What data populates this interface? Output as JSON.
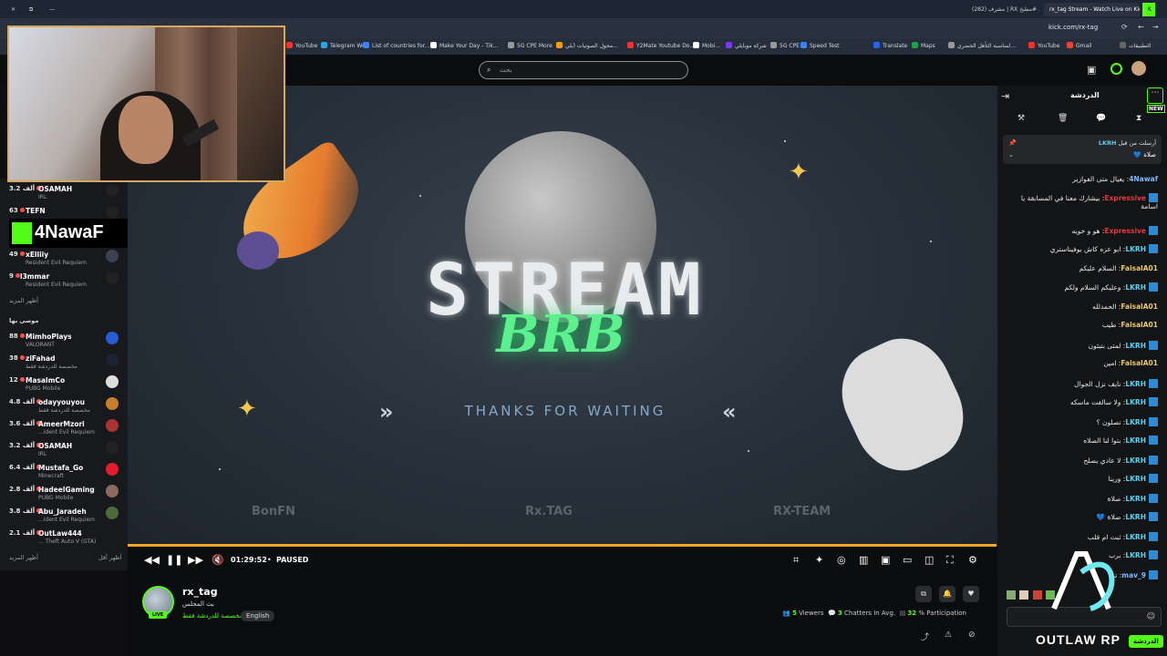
{
  "browser": {
    "tabs": [
      {
        "label": "rx_tag Stream - Watch Live on Kick",
        "active": true
      },
      {
        "label": "(282) مشرف | RX مطبخ# ...",
        "active": false
      }
    ],
    "url": "kick.com/rx-tag",
    "bookmarks": [
      "YouTube",
      "Telegram Web",
      "List of countries for...",
      "Make Your Day - Tik...",
      "5G CPE More",
      "محول الصوتيات (بلي...",
      "Y2Mate Youtube Do...",
      "Mobi...",
      "شركة موبايلي",
      "5G CPE",
      "Speed Test",
      "Translate",
      "Maps",
      "لمناسبة التأهل الحضري...",
      "YouTube",
      "Gmail",
      "التطبيقات"
    ]
  },
  "header": {
    "search_placeholder": "بحث"
  },
  "brand": {
    "letter": "K",
    "name": "4NawaF"
  },
  "sidebar": {
    "top_rows": [
      {
        "count": "3.2 ألف",
        "name": "OSAMAH",
        "sub": "IRL"
      },
      {
        "count": "63",
        "name": "TEFN",
        "sub": ""
      },
      {
        "count": "49",
        "name": "xElliiy",
        "sub": "Resident Evil Requiem"
      },
      {
        "count": "9",
        "name": "l3mmar",
        "sub": "Resident Evil Requiem"
      }
    ],
    "show_more": "أظهر المزيد",
    "recommended_title": "موصى بها",
    "recommended": [
      {
        "count": "88",
        "name": "MimhoPlays",
        "sub": "VALORANT"
      },
      {
        "count": "38",
        "name": "ziFahad",
        "sub": "مخصصة للدردشة فقط"
      },
      {
        "count": "12",
        "name": "MasalmCo",
        "sub": "PUBG Mobile"
      },
      {
        "count": "4.8 ألف",
        "name": "odayyouyou",
        "sub": "مخصصة للدردشة فقط"
      },
      {
        "count": "3.6 ألف",
        "name": "AmeerMzori",
        "sub": "...ident Evil Requiem"
      },
      {
        "count": "3.2 ألف",
        "name": "OSAMAH",
        "sub": "IRL"
      },
      {
        "count": "6.4 ألف",
        "name": "Mustafa_Go",
        "sub": "Minecraft"
      },
      {
        "count": "2.8 ألف",
        "name": "HadeelGaming",
        "sub": "PUBG Mobile"
      },
      {
        "count": "3.8 ألف",
        "name": "Abu_Jaradeh",
        "sub": "...ident Evil Requiem"
      },
      {
        "count": "2.1 ألف",
        "name": "OutLaw444",
        "sub": "... Theft Auto V (GTA)"
      }
    ],
    "show_more_bottom": "أظهر المزيد",
    "show_less": "أظهر أقل"
  },
  "video": {
    "title_big": "STREAM",
    "title_brb": "BRB",
    "thanks": "THANKS FOR WAITING",
    "sponsors": [
      "BonFN",
      "Rx.TAG",
      "RX-TEAM"
    ],
    "progress_fraction": 0.999
  },
  "controls": {
    "time": "01:29:52",
    "state": "PAUSED"
  },
  "channel": {
    "name": "rx_tag",
    "title": "بث المجلس",
    "category": "مخصصة للدردشة فقط",
    "language": "English",
    "live_badge": "LIVE",
    "viewers_num": "5",
    "viewers_label": "Viewers",
    "chatters_num": "3",
    "chatters_label": "Chatters In Avg.",
    "participation_num": "32",
    "participation_label": "% Participation"
  },
  "chat": {
    "title": "الدردشة",
    "new_badge": "NEW",
    "pinned": {
      "user": "LKRH",
      "by": "أرسلت من قبل",
      "text": "صلاة 💙"
    },
    "messages": [
      {
        "user": "4Nawaf",
        "text": "يعيال متى الفوازير",
        "color": "blue",
        "badge": false
      },
      {
        "user": "Expressive",
        "text": "بيشارك معنا في المسابقة يا اسامة",
        "color": "red",
        "badge": true
      },
      {
        "user": "Expressive",
        "text": "هو و خويه",
        "color": "red",
        "badge": true
      },
      {
        "user": "LKRH",
        "text": "ابو عزه كاش بوفيناستري",
        "color": "cyan",
        "badge": true
      },
      {
        "user": "FaisalA01",
        "text": "السلام عليكم",
        "color": "gold",
        "badge": false
      },
      {
        "user": "LKRH",
        "text": "وعليكم السلام ولكم",
        "color": "cyan",
        "badge": true
      },
      {
        "user": "FaisalA01",
        "text": "الحمدلله",
        "color": "gold",
        "badge": false
      },
      {
        "user": "FaisalA01",
        "text": "طيب",
        "color": "gold",
        "badge": false
      },
      {
        "user": "LKRH",
        "text": "لمتى بتبثون",
        "color": "cyan",
        "badge": true
      },
      {
        "user": "FaisalA01",
        "text": "امين",
        "color": "gold",
        "badge": false
      },
      {
        "user": "LKRH",
        "text": "نايف نزل الجوال",
        "color": "cyan",
        "badge": true
      },
      {
        "user": "LKRH",
        "text": "ولا سالفت ماسكه",
        "color": "cyan",
        "badge": true
      },
      {
        "user": "LKRH",
        "text": "تصلون ؟",
        "color": "cyan",
        "badge": true
      },
      {
        "user": "LKRH",
        "text": "بتوا لنا الصلاه",
        "color": "cyan",
        "badge": true
      },
      {
        "user": "LKRH",
        "text": "لا عادي يصلح",
        "color": "cyan",
        "badge": true
      },
      {
        "user": "LKRH",
        "text": "ورينا",
        "color": "cyan",
        "badge": true
      },
      {
        "user": "LKRH",
        "text": "صلاة",
        "color": "cyan",
        "badge": true
      },
      {
        "user": "LKRH",
        "text": "صلاة 💙",
        "color": "cyan",
        "badge": true
      },
      {
        "user": "LKRH",
        "text": "ثبت ام قلب",
        "color": "cyan",
        "badge": true
      },
      {
        "user": "LKRH",
        "text": "برب",
        "color": "cyan",
        "badge": true
      },
      {
        "user": "mav_9",
        "text": "تم",
        "color": "blue",
        "badge": true
      }
    ],
    "send_label": "الدردشة"
  },
  "watermark": {
    "text": "OUTLAW RP"
  },
  "colors": {
    "kick_green": "#53fc18",
    "progress": "#f5a623"
  }
}
